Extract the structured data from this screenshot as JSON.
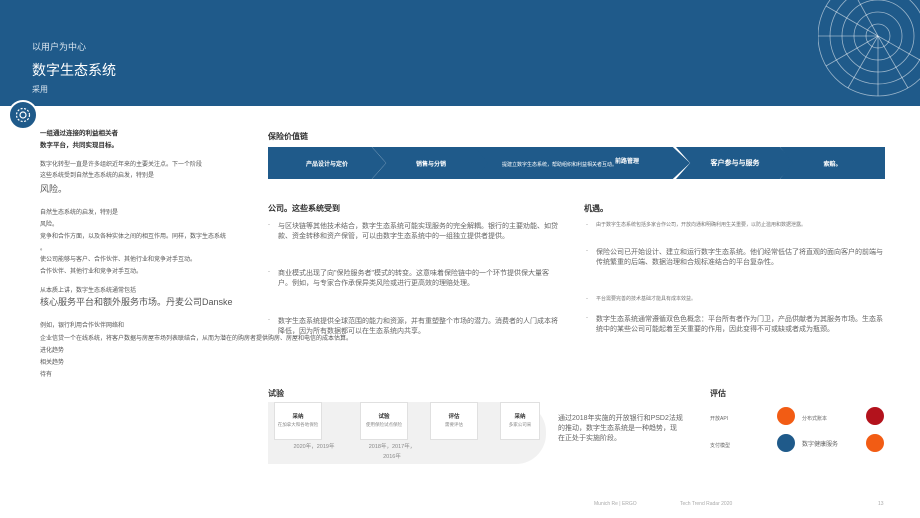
{
  "header": {
    "kicker": "以用户为中心",
    "title": "数字生态系统",
    "subtitle": "采用"
  },
  "left": {
    "intro1": "一组通过连接的利益相关者",
    "intro2": "数字平台，共同实现目标。",
    "p1a": "数字化转型一直是许多组织近年来的主要关注点。下一个阶段",
    "p1b": "这些系统受到自然生态系统的启发，特别是",
    "p1c": "风险。",
    "p2a": "自然生态系统的启发，特别是",
    "p2b": "风险。",
    "p2c": "竞争和合作方面，以及各种实体之间的相互作用。同样，数字生态系统",
    "p2d": "。",
    "p3a": "使公司能够与客户、合作伙伴、其他行业和竞争对手互动。",
    "p3b": "合作伙伴、其他行业和竞争对手互动。",
    "p4a": "从本质上讲，数字生态系统通常包括",
    "p4b": "核心服务平台和额外服务市场。丹麦公司Danske",
    "p5a": "例如，银行利用合作伙伴网络和",
    "p5b": "企业信贷一个在线系统，将客户数据与房屋市场列表联结合，从而为潜在的购房者提供购房、房屋和电信的成本估算。",
    "p5c": "进化趋势",
    "p5d": "相关趋势",
    "p5e": "待有"
  },
  "value_chain": {
    "heading": "保险价值链",
    "steps": [
      "产品设计与定价",
      "销售与分销",
      "前路管理",
      "客户参与与服务",
      "索赔。"
    ],
    "overlay": "提建立数字生态系统，帮助组织和利益相关者互动。"
  },
  "company": {
    "heading": "公司。这些系统受到",
    "b1": "与区块链等其他技术结合，数字生态系统可能实现服务的完全解耦。银行的主要劝能、如贷款、资金转移和资产保管，可以由数字生态系统中的一组独立提供者提供。",
    "b2": "商业模式出现了向\"保险服务者\"模式的转变。这意味着保险链中的一个环节提供保大量客户。例如，与专家合作承保异类风险或进行更高效的理赔处理。",
    "b3": "数字生态系统提供全球范围的能力和资源，并有重塑整个市场的潜力。消费者的人门成本将降低，因为所有数据都可以在生态系统内共享。"
  },
  "opportunity": {
    "heading": "机遇。",
    "o1": "由于数字生态系统包括多家合作公司，开放向通和明确利用生关重要，以防止滥用和数据泄露。",
    "o2": "保险公司已开始设计、建立和运行数字生态系统。他们经常低估了将直观的面向客户的前端与传统繁重的后端、数据治理和合规标准结合的平台复杂性。",
    "o3": "平台需要完善的技术基础才能具有成本效益。",
    "o4": "数字生态系统通常遵循双色色概念：平台所有者作为门卫，产品供献者为其服务市场。生态系统中的某些公司可能起着至关重要的作用，因此变得不可或缺或者成为瓶颈。"
  },
  "trial": {
    "heading": "试验",
    "cards": [
      {
        "title": "采纳",
        "desc": "在加拿大和各地保险"
      },
      {
        "title": "试验",
        "desc": "使用保险试点保险"
      },
      {
        "title": "评估",
        "desc": "需要评估"
      },
      {
        "title": "采纳",
        "desc": "多家公司采"
      }
    ],
    "years1": "2020年，2019年",
    "years2a": "2018年，2017年，",
    "years2b": "2016年",
    "note": "通过2018年实施的开放银行和PSD2法规的推动，数字生态系统是一种趋势，现在正处于实施阶段。"
  },
  "eval": {
    "heading": "评估",
    "l1": "开放API",
    "l2": "支付模型",
    "r1": "分布式账本",
    "r2": "数字健康服务",
    "colors": {
      "orange": "#f25c14",
      "red": "#b3121c",
      "blue": "#1f5a8a"
    }
  },
  "footer": {
    "left": "Munich Re | ERGO",
    "center": "Tech Trend Radar 2020",
    "page": "13"
  }
}
